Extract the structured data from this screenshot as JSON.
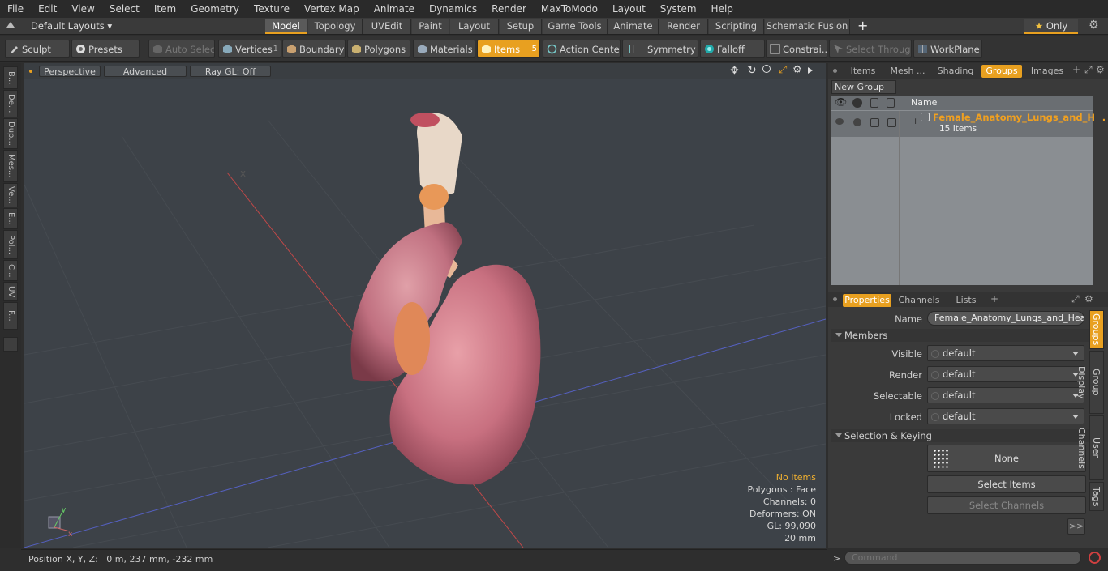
{
  "menu": [
    "File",
    "Edit",
    "View",
    "Select",
    "Item",
    "Geometry",
    "Texture",
    "Vertex Map",
    "Animate",
    "Dynamics",
    "Render",
    "MaxToModo",
    "Layout",
    "System",
    "Help"
  ],
  "layout_bar": {
    "layouts_label": "Default Layouts",
    "tabs": [
      "Model",
      "Topology",
      "UVEdit",
      "Paint",
      "Layout",
      "Setup",
      "Game Tools",
      "Animate",
      "Render",
      "Scripting",
      "Schematic Fusion"
    ],
    "add_label": "+",
    "only_label": "Only"
  },
  "toolbar": {
    "sculpt": "Sculpt",
    "presets": "Presets",
    "auto_select": "Auto Select",
    "vertices": "Vertices",
    "vertices_count": "1",
    "boundary": "Boundary",
    "polygons": "Polygons",
    "materials": "Materials",
    "items": "Items",
    "items_count": "5",
    "action_center": "Action Center",
    "symmetry": "Symmetry",
    "falloff": "Falloff",
    "constraints": "Constrai...",
    "select_through": "Select Through",
    "workplane": "WorkPlane"
  },
  "left_tabs": [
    "B...",
    "De...",
    "Dup...",
    "Mes...",
    "Ve...",
    "E...",
    "Pol...",
    "C...",
    "UV",
    "F..."
  ],
  "viewport": {
    "perspective": "Perspective",
    "advanced": "Advanced",
    "raygl": "Ray GL: Off",
    "info": {
      "no_items": "No Items",
      "polygons": "Polygons : Face",
      "channels": "Channels: 0",
      "deformers": "Deformers: ON",
      "gl": "GL: 99,090",
      "scale": "20 mm"
    }
  },
  "status": {
    "position": "Position X, Y, Z:   0 m, 237 mm, -232 mm"
  },
  "groups_panel": {
    "tabs": [
      "Items",
      "Mesh ...",
      "Shading",
      "Groups",
      "Images"
    ],
    "active_tab": "Groups",
    "new_group": "New Group",
    "column_name": "Name",
    "group_name": "Female_Anatomy_Lungs_and_H...",
    "group_count": "15 Items"
  },
  "properties_panel": {
    "tabs": [
      "Properties",
      "Channels",
      "Lists"
    ],
    "name_label": "Name",
    "name_value": "Female_Anatomy_Lungs_and_Heart (",
    "members_section": "Members",
    "rows": [
      {
        "label": "Visible",
        "value": "default"
      },
      {
        "label": "Render",
        "value": "default"
      },
      {
        "label": "Selectable",
        "value": "default"
      },
      {
        "label": "Locked",
        "value": "default"
      }
    ],
    "selection_section": "Selection & Keying",
    "none_label": "None",
    "select_items": "Select Items",
    "select_channels": "Select Channels",
    "more": ">>",
    "side_tabs": [
      "Groups",
      "Group Display",
      "User Channels",
      "Tags"
    ]
  },
  "command": {
    "prompt": ">",
    "placeholder": "Command"
  },
  "colors": {
    "accent": "#e8a020",
    "group_name": "#f0a020"
  }
}
